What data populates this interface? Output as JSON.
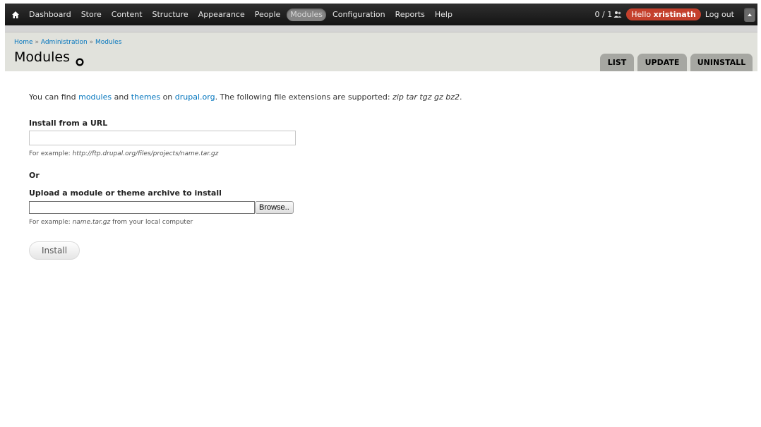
{
  "toolbar": {
    "home_icon": "home-icon",
    "nav_items": [
      {
        "label": "Dashboard",
        "active": false
      },
      {
        "label": "Store",
        "active": false
      },
      {
        "label": "Content",
        "active": false
      },
      {
        "label": "Structure",
        "active": false
      },
      {
        "label": "Appearance",
        "active": false
      },
      {
        "label": "People",
        "active": false
      },
      {
        "label": "Modules",
        "active": true
      },
      {
        "label": "Configuration",
        "active": false
      },
      {
        "label": "Reports",
        "active": false
      },
      {
        "label": "Help",
        "active": false
      }
    ],
    "user_count": "0 / 1",
    "user_count_icon": "users-icon",
    "hello_prefix": "Hello",
    "username": "xristinath",
    "logout_label": "Log out",
    "drawer_icon": "triangle-up-icon"
  },
  "header": {
    "breadcrumb": [
      "Home",
      "Administration",
      "Modules"
    ],
    "breadcrumb_separator": "»",
    "title": "Modules",
    "shortcut_icon": "add-shortcut-icon"
  },
  "tabs": [
    {
      "label": "LIST"
    },
    {
      "label": "UPDATE"
    },
    {
      "label": "UNINSTALL"
    }
  ],
  "content": {
    "intro": {
      "prefix": "You can find",
      "modules_link": "modules",
      "and": "and",
      "themes_link": "themes",
      "on": "on",
      "drupal_link": "drupal.org",
      "suffix": ". The following file extensions are supported:",
      "extensions": "zip tar tgz gz bz2",
      "end": "."
    },
    "url_label": "Install from a URL",
    "url_value": "",
    "url_desc_prefix": "For example:",
    "url_desc_example": "http://ftp.drupal.org/files/projects/name.tar.gz",
    "or_label": "Or",
    "upload_label": "Upload a module or theme archive to install",
    "browse_label": "Browse..",
    "upload_desc_prefix": "For example:",
    "upload_desc_example": "name.tar.gz",
    "upload_desc_suffix": "from your local computer",
    "install_label": "Install"
  },
  "colors": {
    "toolbar_bg": "#1f1f1f",
    "header_bg": "#e1e2dc",
    "tab_bg": "#a6a7a2",
    "link": "#0074bd",
    "hello_badge": "#c4402c"
  }
}
